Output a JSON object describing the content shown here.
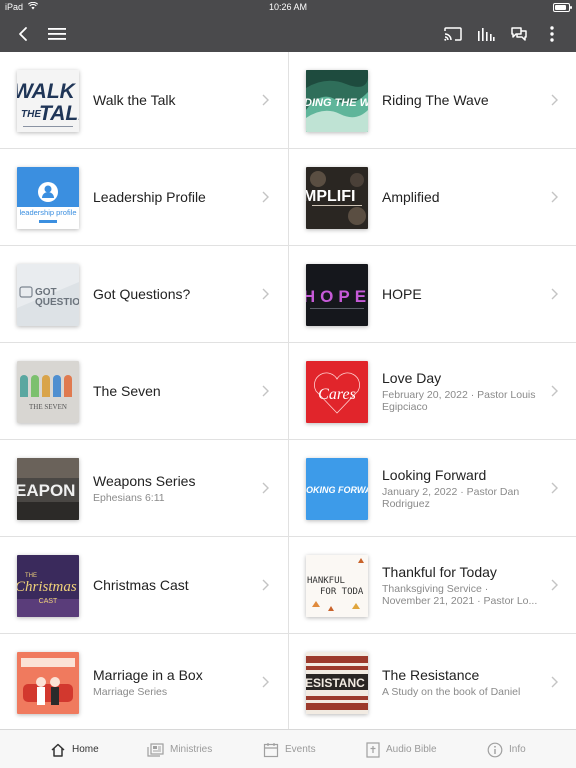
{
  "status": {
    "device": "iPad",
    "time": "10:26 AM",
    "battery_level": 0.85
  },
  "appbar": {
    "back_icon": "chevron-left-icon",
    "menu_icon": "hamburger-icon",
    "cast_icon": "cast-icon",
    "audio_icon": "audio-bars-icon",
    "chat_icon": "chat-bubbles-icon",
    "more_icon": "more-vertical-icon"
  },
  "items": [
    {
      "title": "Walk the Talk",
      "subtitle": "",
      "art": "walk-the-talk-artwork"
    },
    {
      "title": "Riding The Wave",
      "subtitle": "",
      "art": "riding-the-wave-artwork"
    },
    {
      "title": "Leadership Profile",
      "subtitle": "",
      "art": "leadership-profile-artwork",
      "art_text": "leadership profile"
    },
    {
      "title": "Amplified",
      "subtitle": "",
      "art": "amplified-artwork"
    },
    {
      "title": "Got Questions?",
      "subtitle": "",
      "art": "got-questions-artwork"
    },
    {
      "title": "HOPE",
      "subtitle": "",
      "art": "hope-artwork",
      "art_text": "HOPE"
    },
    {
      "title": "The Seven",
      "subtitle": "",
      "art": "the-seven-artwork",
      "art_text": "THE SEVEN"
    },
    {
      "title": "Love Day",
      "subtitle": "February 20, 2022 · Pastor Louis Egipciaco",
      "art": "love-day-artwork"
    },
    {
      "title": "Weapons Series",
      "subtitle": "Ephesians 6:11",
      "art": "weapons-series-artwork"
    },
    {
      "title": "Looking Forward",
      "subtitle": "January 2, 2022 · Pastor Dan Rodriguez",
      "art": "looking-forward-artwork"
    },
    {
      "title": "Christmas Cast",
      "subtitle": "",
      "art": "christmas-cast-artwork",
      "art_text": "CAST"
    },
    {
      "title": "Thankful for Today",
      "subtitle": "Thanksgiving Service · November 21, 2021 · Pastor Lo...",
      "art": "thankful-for-today-artwork"
    },
    {
      "title": "Marriage in a Box",
      "subtitle": "Marriage Series",
      "art": "marriage-in-a-box-artwork"
    },
    {
      "title": "The Resistance",
      "subtitle": "A Study on the book of Daniel",
      "art": "the-resistance-artwork"
    }
  ],
  "tabs": [
    {
      "label": "Home",
      "icon": "home-icon",
      "active": true
    },
    {
      "label": "Ministries",
      "icon": "ministries-icon",
      "active": false
    },
    {
      "label": "Events",
      "icon": "calendar-icon",
      "active": false
    },
    {
      "label": "Audio Bible",
      "icon": "audio-bible-icon",
      "active": false
    },
    {
      "label": "Info",
      "icon": "info-icon",
      "active": false
    }
  ]
}
